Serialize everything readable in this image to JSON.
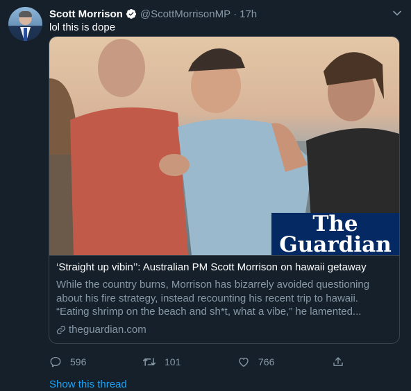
{
  "tweet": {
    "author_name": "Scott Morrison",
    "handle": "@ScottMorrisonMP",
    "separator": "·",
    "time": "17h",
    "text": "lol this is dope",
    "verified": true
  },
  "card": {
    "image_logo_line1": "The",
    "image_logo_line2": "Guardian",
    "title": "‘Straight up vibin’’: Australian PM Scott Morrison on hawaii getaway",
    "description": "While the country burns, Morrison has bizarrely avoided questioning about his fire strategy, instead recounting his recent trip to hawaii. “Eating shrimp on the beach and sh*t, what a vibe,” he lamented...",
    "domain": "theguardian.com"
  },
  "actions": {
    "replies": "596",
    "retweets": "101",
    "likes": "766"
  },
  "show_thread": "Show this thread",
  "colors": {
    "background": "#15202b",
    "secondary_text": "#8899a6",
    "accent": "#1da1f2",
    "border": "#38444d",
    "guardian_blue": "#052962"
  },
  "icons": [
    "verified-badge-icon",
    "chevron-down-icon",
    "link-icon",
    "reply-icon",
    "retweet-icon",
    "like-icon",
    "share-icon"
  ]
}
